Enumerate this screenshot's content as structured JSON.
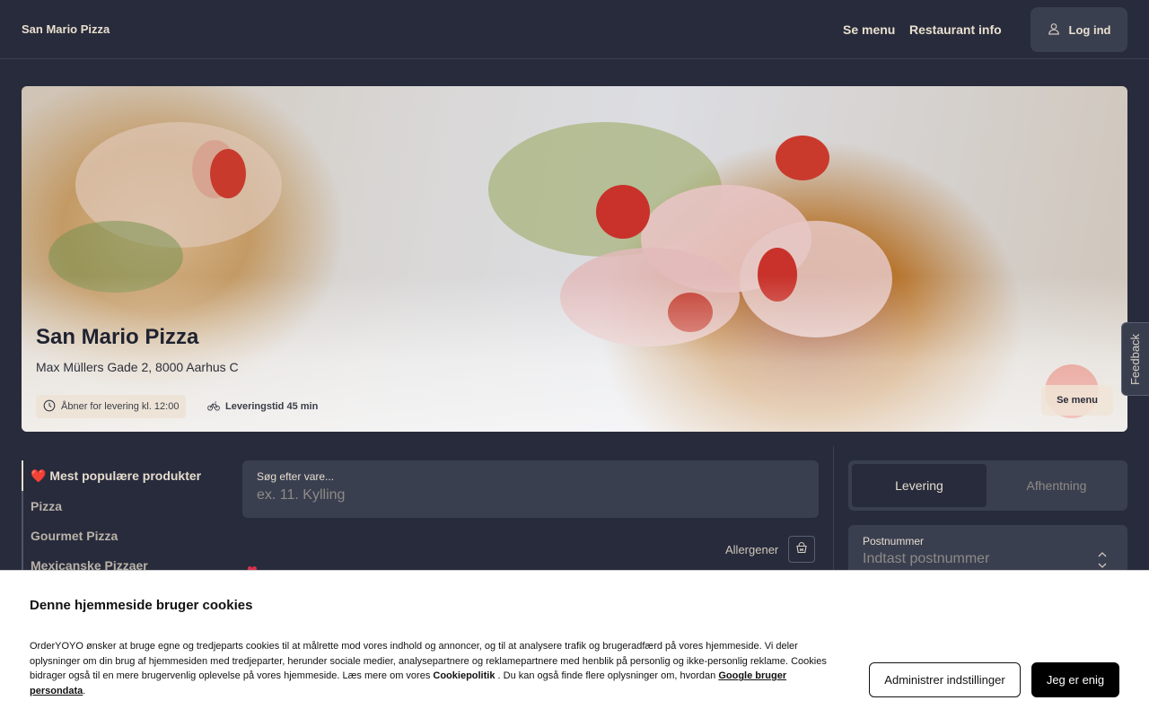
{
  "header": {
    "brand": "San Mario Pizza",
    "nav": {
      "menu": "Se menu",
      "info": "Restaurant info"
    },
    "login_label": "Log ind"
  },
  "hero": {
    "title": "San Mario Pizza",
    "address": "Max Müllers Gade 2, 8000 Aarhus C",
    "opening_chip": "Åbner for levering kl. 12:00",
    "delivery_chip": "Leveringstid 45 min",
    "menu_button": "Se menu"
  },
  "feedback_label": "Feedback",
  "categories": [
    {
      "label": "❤️ Mest populære produkter",
      "active": true
    },
    {
      "label": "Pizza",
      "active": false
    },
    {
      "label": "Gourmet Pizza",
      "active": false
    },
    {
      "label": "Mexicanske Pizzaer",
      "active": false
    }
  ],
  "search": {
    "label": "Søg efter vare...",
    "placeholder": "ex. 11. Kylling",
    "allergen_label": "Allergener"
  },
  "order_mode": {
    "delivery": "Levering",
    "pickup": "Afhentning",
    "selected": "Levering"
  },
  "postcode": {
    "label": "Postnummer",
    "placeholder": "Indtast postnummer"
  },
  "cookie_banner": {
    "title": "Denne hjemmeside bruger cookies",
    "text_before": "OrderYOYO ønsker at bruge egne og tredjeparts cookies til at målrette mod vores indhold og annoncer, og til at analysere trafik og brugeradfærd på vores hjemmeside. Vi deler oplysninger om din brug af hjemmesiden med tredjeparter, herunder sociale medier, analysepartnere og reklamepartnere med henblik på personlig og ikke-personlig reklame. Cookies bidrager også til en mere brugervenlig oplevelse på vores hjemmeside. Læs mere om vores ",
    "cookie_policy_link": "Cookiepolitik",
    "text_middle": " . Du kan også finde flere oplysninger om, hvordan ",
    "google_link": "Google bruger persondata",
    "text_end": ".",
    "settings_button": "Administrer indstillinger",
    "agree_button": "Jeg er enig"
  }
}
